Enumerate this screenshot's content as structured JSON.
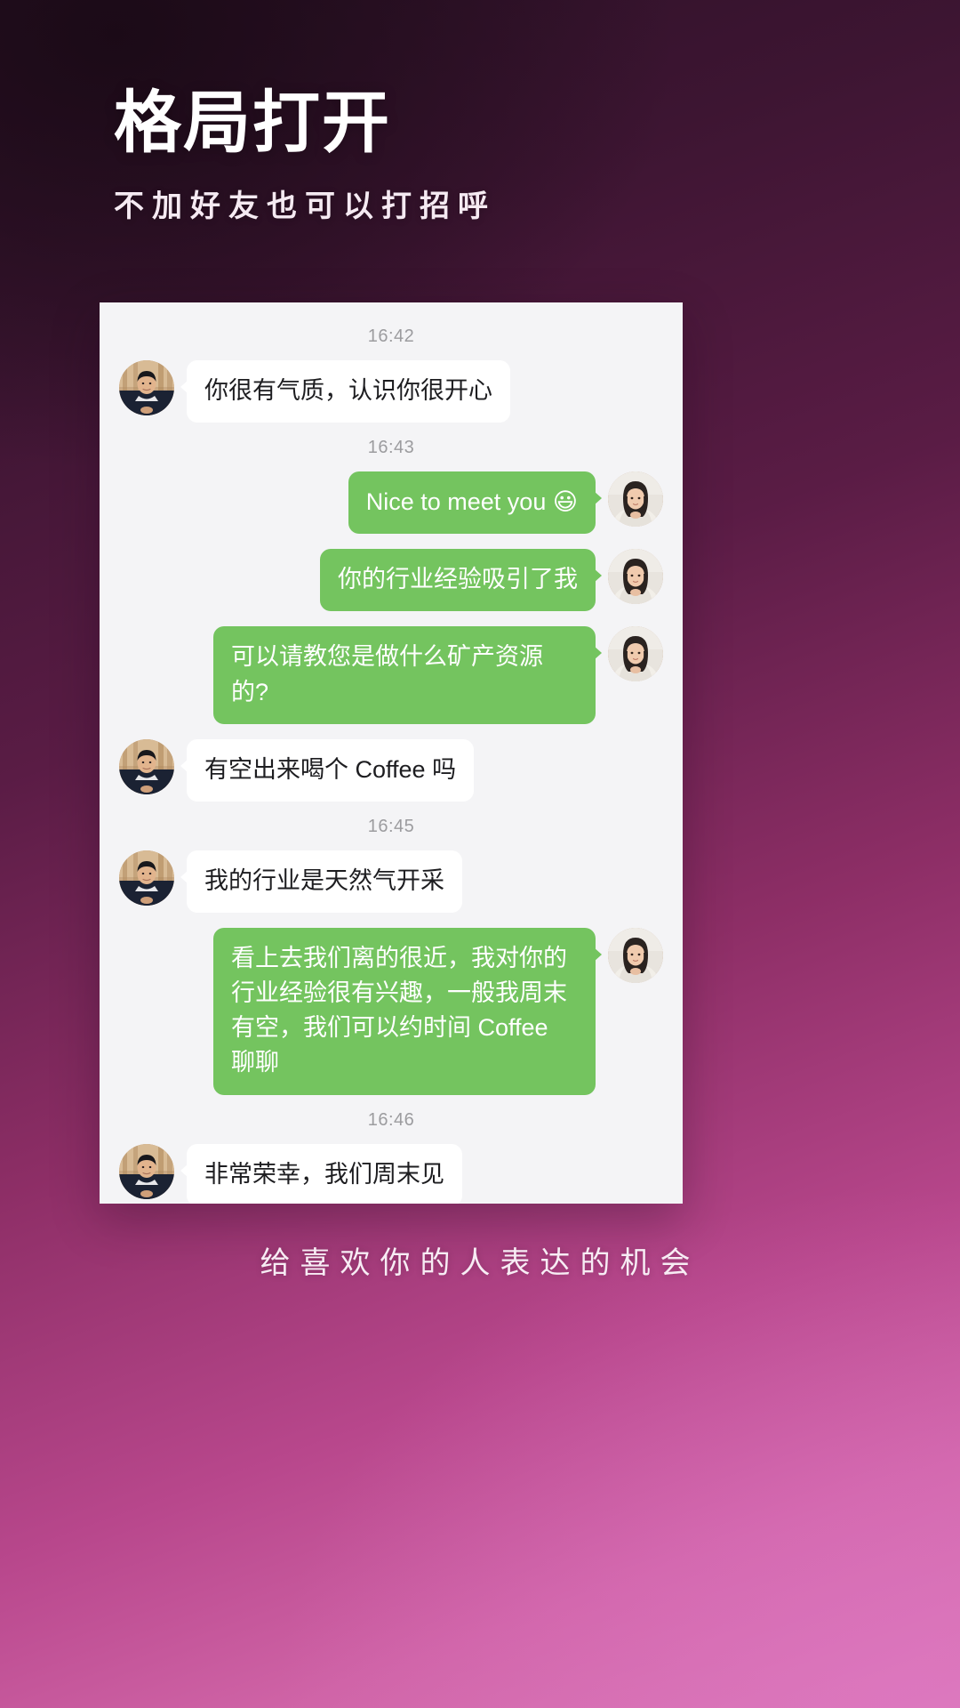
{
  "header": {
    "title": "格局打开",
    "subtitle": "不加好友也可以打招呼"
  },
  "footer": {
    "text": "给喜欢你的人表达的机会"
  },
  "colors": {
    "outgoing_bubble": "#74c45f",
    "incoming_bubble": "#ffffff",
    "chat_background": "#f4f4f6",
    "timestamp_text": "#9c9c9f",
    "title_text": "#ffffff"
  },
  "chat": {
    "items": [
      {
        "kind": "time",
        "text": "16:42"
      },
      {
        "kind": "message",
        "side": "in",
        "text": "你很有气质，认识你很开心",
        "avatar": "man-avatar"
      },
      {
        "kind": "time",
        "text": "16:43"
      },
      {
        "kind": "message",
        "side": "out",
        "text": "Nice to meet you ",
        "emoji": "😃",
        "avatar": "woman-avatar"
      },
      {
        "kind": "message",
        "side": "out",
        "text": "你的行业经验吸引了我",
        "avatar": "woman-avatar"
      },
      {
        "kind": "message",
        "side": "out",
        "text": "可以请教您是做什么矿产资源的?",
        "avatar": "woman-avatar"
      },
      {
        "kind": "message",
        "side": "in",
        "text": "有空出来喝个 Coffee 吗",
        "avatar": "man-avatar"
      },
      {
        "kind": "time",
        "text": "16:45"
      },
      {
        "kind": "message",
        "side": "in",
        "text": "我的行业是天然气开采",
        "avatar": "man-avatar"
      },
      {
        "kind": "message",
        "side": "out",
        "text": "看上去我们离的很近，我对你的行业经验很有兴趣，一般我周末有空，我们可以约时间 Coffee 聊聊",
        "avatar": "woman-avatar"
      },
      {
        "kind": "time",
        "text": "16:46"
      },
      {
        "kind": "message",
        "side": "in",
        "text": "非常荣幸，我们周末见",
        "avatar": "man-avatar"
      }
    ]
  }
}
